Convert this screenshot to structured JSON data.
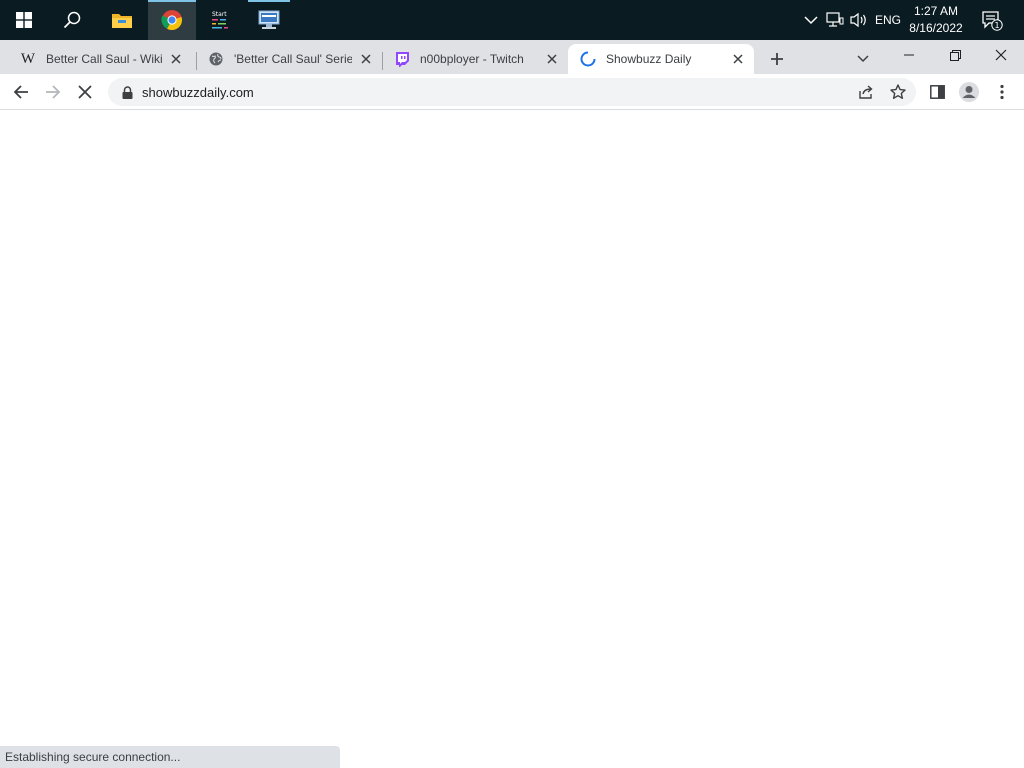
{
  "taskbar": {
    "apps": [
      {
        "name": "Start",
        "icon": "windows-logo-icon"
      },
      {
        "name": "Search",
        "icon": "search-icon"
      },
      {
        "name": "File Explorer",
        "icon": "folder-icon"
      },
      {
        "name": "Google Chrome",
        "icon": "chrome-icon"
      },
      {
        "name": "Start",
        "icon": "start-app-icon",
        "label": "Start"
      },
      {
        "name": "Network app",
        "icon": "network-computer-icon"
      }
    ],
    "tray": {
      "language": "ENG",
      "time": "1:27 AM",
      "date": "8/16/2022",
      "notification_count": "1"
    }
  },
  "browser": {
    "tabs": [
      {
        "title": "Better Call Saul - Wikipedia",
        "favicon": "wikipedia-icon",
        "favicon_text": "W"
      },
      {
        "title": "'Better Call Saul' Series Finale",
        "favicon": "globe-icon"
      },
      {
        "title": "n00bployer - Twitch",
        "favicon": "twitch-icon"
      },
      {
        "title": "Showbuzz Daily",
        "favicon": "loading-spinner-icon",
        "active": true
      }
    ],
    "address": "showbuzzdaily.com",
    "status_text": "Establishing secure connection...",
    "colors": {
      "tab_strip": "#dfe1e5",
      "taskbar": "#0b1b22",
      "twitch": "#9146ff",
      "spinner": "#1a73e8"
    }
  }
}
